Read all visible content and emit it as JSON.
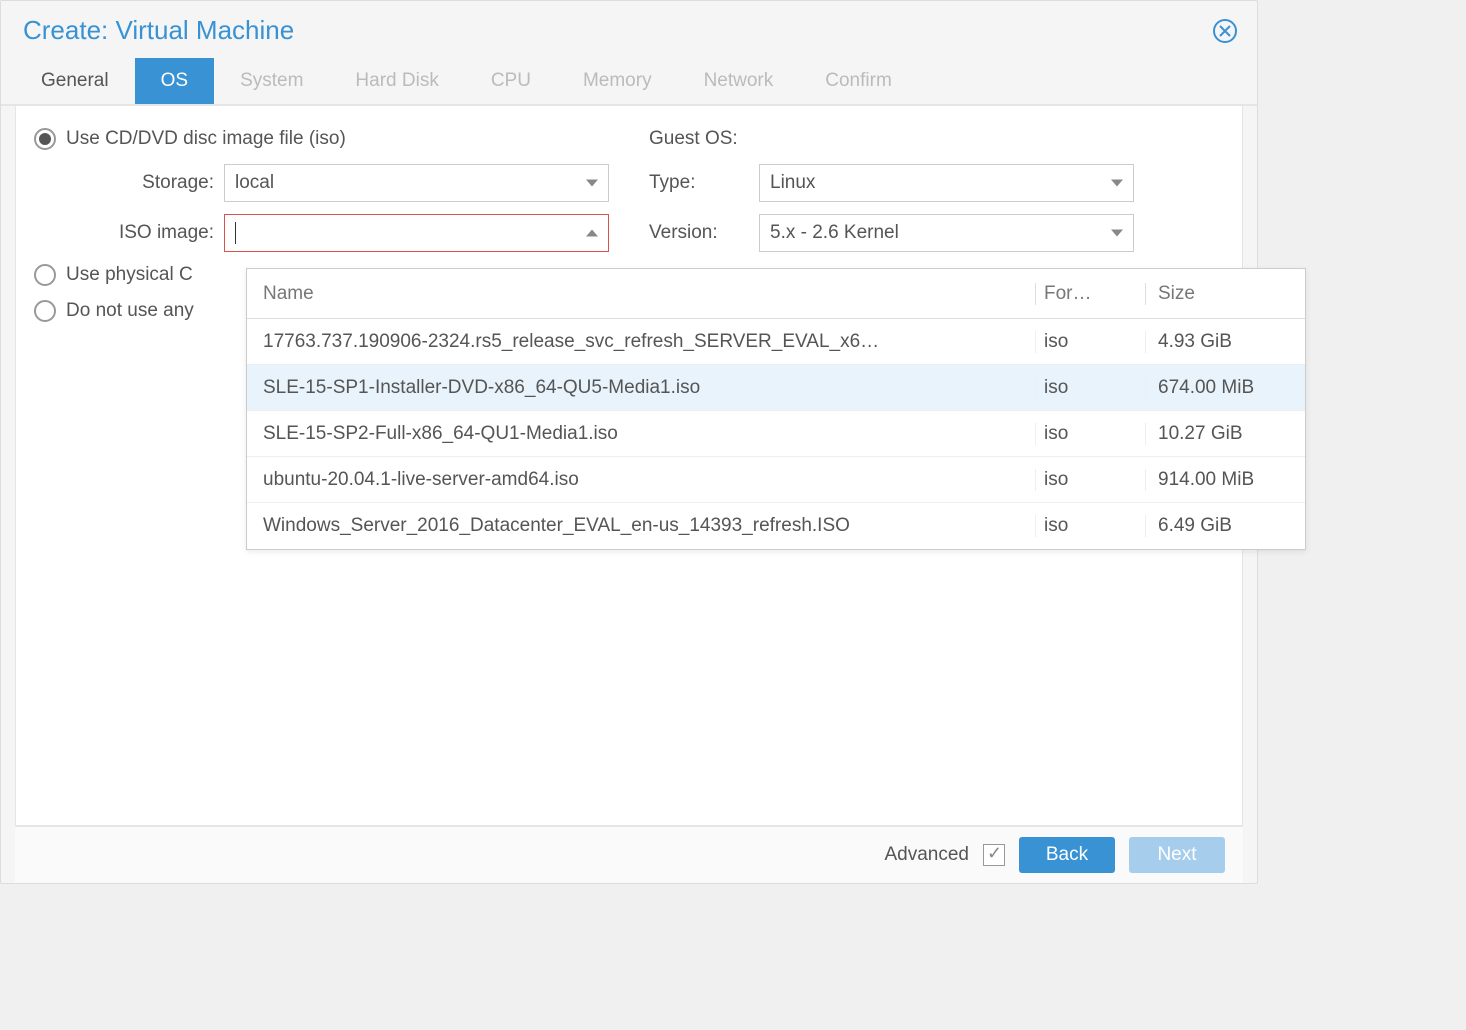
{
  "modal": {
    "title": "Create: Virtual Machine"
  },
  "tabs": [
    {
      "label": "General",
      "state": "enabled"
    },
    {
      "label": "OS",
      "state": "active"
    },
    {
      "label": "System",
      "state": "disabled"
    },
    {
      "label": "Hard Disk",
      "state": "disabled"
    },
    {
      "label": "CPU",
      "state": "disabled"
    },
    {
      "label": "Memory",
      "state": "disabled"
    },
    {
      "label": "Network",
      "state": "disabled"
    },
    {
      "label": "Confirm",
      "state": "disabled"
    }
  ],
  "radios": {
    "use_iso": "Use CD/DVD disc image file (iso)",
    "use_physical": "Use physical C",
    "no_media": "Do not use any"
  },
  "fields": {
    "storage_label": "Storage:",
    "storage_value": "local",
    "iso_label": "ISO image:",
    "iso_value": "",
    "guest_os_label": "Guest OS:",
    "type_label": "Type:",
    "type_value": "Linux",
    "version_label": "Version:",
    "version_value": "5.x - 2.6 Kernel"
  },
  "dropdown": {
    "headers": {
      "name": "Name",
      "format": "For…",
      "size": "Size"
    },
    "rows": [
      {
        "name": "17763.737.190906-2324.rs5_release_svc_refresh_SERVER_EVAL_x6…",
        "format": "iso",
        "size": "4.93 GiB"
      },
      {
        "name": "SLE-15-SP1-Installer-DVD-x86_64-QU5-Media1.iso",
        "format": "iso",
        "size": "674.00 MiB",
        "highlighted": true
      },
      {
        "name": "SLE-15-SP2-Full-x86_64-QU1-Media1.iso",
        "format": "iso",
        "size": "10.27 GiB"
      },
      {
        "name": "ubuntu-20.04.1-live-server-amd64.iso",
        "format": "iso",
        "size": "914.00 MiB"
      },
      {
        "name": "Windows_Server_2016_Datacenter_EVAL_en-us_14393_refresh.ISO",
        "format": "iso",
        "size": "6.49 GiB"
      }
    ]
  },
  "footer": {
    "advanced_label": "Advanced",
    "back_label": "Back",
    "next_label": "Next"
  }
}
